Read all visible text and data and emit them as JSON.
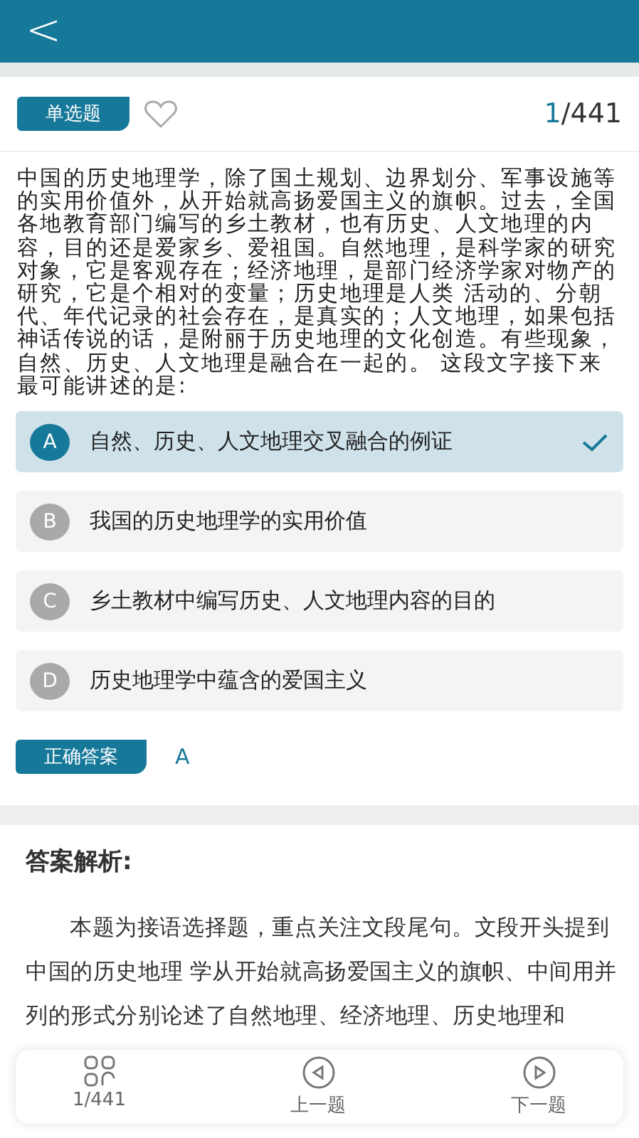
{
  "header": {
    "back": "<"
  },
  "question": {
    "type_label": "单选题",
    "favorited": false,
    "current": "1",
    "total": "/441",
    "text": "中国的历史地理学，除了国土规划、边界划分、军事设施等的实用价值外，从开始就高扬爱国主义的旗帜。过去，全国各地教育部门编写的乡土教材，也有历史、人文地理的内容，目的还是爱家乡、爱祖国。自然地理，是科学家的研究对象，它是客观存在；经济地理，是部门经济学家对物产的研究，它是个相对的变量；历史地理是人类 活动的、分朝代、年代记录的社会存在，是真实的；人文地理，如果包括神话传说的话，是附丽于历史地理的文化创造。有些现象，自然、历史、人文地理是融合在一起的。 这段文字接下来最可能讲述的是:"
  },
  "options": [
    {
      "letter": "A",
      "text": "自然、历史、人文地理交叉融合的例证",
      "selected": true
    },
    {
      "letter": "B",
      "text": "我国的历史地理学的实用价值",
      "selected": false
    },
    {
      "letter": "C",
      "text": "乡土教材中编写历史、人文地理内容的目的",
      "selected": false
    },
    {
      "letter": "D",
      "text": "历史地理学中蕴含的爱国主义",
      "selected": false
    }
  ],
  "correct_answer": {
    "label": "正确答案",
    "value": "A"
  },
  "analysis": {
    "title": "答案解析:",
    "text": "本题为接语选择题，重点关注文段尾句。文段开头提到中国的历史地理 学从开始就高扬爱国主义的旗帜、中间用并列的形式分别论述了自然地理、经济地理、历史地理和"
  },
  "bottom_nav": [
    {
      "kind": "grid",
      "label": "1/441"
    },
    {
      "kind": "prev",
      "label": "上一题"
    },
    {
      "kind": "next",
      "label": "下一题"
    }
  ]
}
